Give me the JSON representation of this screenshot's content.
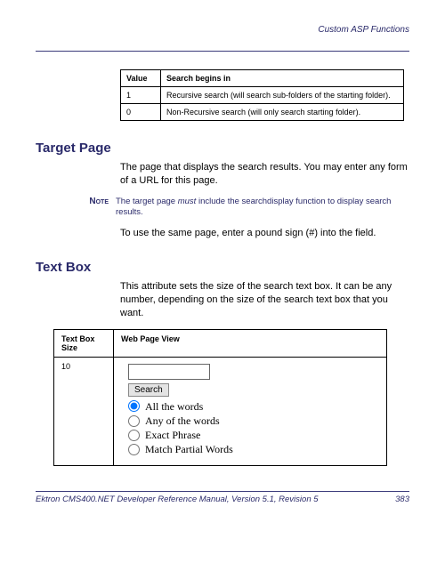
{
  "header": {
    "section": "Custom ASP Functions"
  },
  "value_table": {
    "head": {
      "c1": "Value",
      "c2": "Search begins in"
    },
    "rows": [
      {
        "c1": "1",
        "c2": "Recursive search (will search sub-folders of the starting folder)."
      },
      {
        "c1": "0",
        "c2": "Non-Recursive search (will only search starting folder)."
      }
    ]
  },
  "target_page": {
    "heading": "Target Page",
    "p1": "The page that displays the search results. You may enter any form of a URL for this page.",
    "note_label": "Note",
    "note_text_pre": "The target page ",
    "note_text_em": "must",
    "note_text_post": " include the searchdisplay function to display search results.",
    "p2": "To use the same page, enter a pound sign (#) into the field."
  },
  "text_box": {
    "heading": "Text Box",
    "p1": "This attribute sets the size of the search text box. It can be any number, depending on the size of the search text box that you want.",
    "table": {
      "head": {
        "c1": "Text Box Size",
        "c2": "Web Page View"
      },
      "row": {
        "size": "10",
        "widget": {
          "search_btn": "Search",
          "options": [
            {
              "label": "All the words",
              "checked": true
            },
            {
              "label": "Any of the words",
              "checked": false
            },
            {
              "label": "Exact Phrase",
              "checked": false
            },
            {
              "label": "Match Partial Words",
              "checked": false
            }
          ]
        }
      }
    }
  },
  "footer": {
    "left": "Ektron CMS400.NET Developer Reference Manual, Version 5.1, Revision 5",
    "right": "383"
  }
}
